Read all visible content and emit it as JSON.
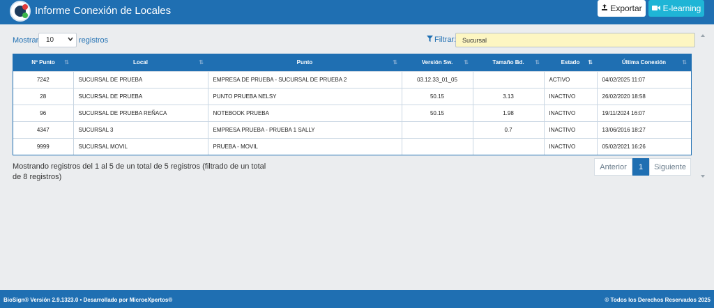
{
  "header": {
    "title": "Informe Conexión de Locales",
    "export_label": "Exportar",
    "elearning_label": "E-learning"
  },
  "controls": {
    "show_label": "Mostrar",
    "page_length": "10",
    "records_label": "registros",
    "filter_label": "Filtrar:",
    "filter_value": "Sucursal"
  },
  "table": {
    "columns": [
      "Nº Punto",
      "Local",
      "Punto",
      "Versión Sw.",
      "Tamaño Bd.",
      "Estado",
      "Última Conexión"
    ],
    "rows": [
      [
        "7242",
        "SUCURSAL DE PRUEBA",
        "EMPRESA DE PRUEBA - SUCURSAL DE PRUEBA 2",
        "03.12.33_01_05",
        "",
        "ACTIVO",
        "04/02/2025 11:07"
      ],
      [
        "28",
        "SUCURSAL DE PRUEBA",
        "PUNTO PRUEBA NELSY",
        "50.15",
        "3.13",
        "INACTIVO",
        "26/02/2020 18:58"
      ],
      [
        "96",
        "SUCURSAL DE PRUEBA REÑACA",
        "NOTEBOOK PRUEBA",
        "50.15",
        "1.98",
        "INACTIVO",
        "19/11/2024 16:07"
      ],
      [
        "4347",
        "SUCURSAL 3",
        "EMPRESA PRUEBA - PRUEBA 1 SALLY",
        "",
        "0.7",
        "INACTIVO",
        "13/06/2016 18:27"
      ],
      [
        "9999",
        "SUCURSAL MOVIL",
        "PRUEBA - MOVIL",
        "",
        "",
        "INACTIVO",
        "05/02/2021 16:26"
      ]
    ]
  },
  "info_text": "Mostrando registros del 1 al 5 de un total de 5 registros (filtrado de un total de 8 registros)",
  "pagination": {
    "previous": "Anterior",
    "current": "1",
    "next": "Siguiente"
  },
  "footer": {
    "left": "BioSign® Versión 2.9.1323.0 • Desarrollado por MicroeXpertos®",
    "right": "© Todos los Derechos Reservados 2025"
  },
  "colors": {
    "primary": "#1f6fb2",
    "accent": "#1fb5d6",
    "filter_bg": "#fdf6c2"
  },
  "icons": {
    "export": "export-icon",
    "elearning": "video-camera-icon",
    "filter": "funnel-icon",
    "sort": "sort-icon"
  }
}
